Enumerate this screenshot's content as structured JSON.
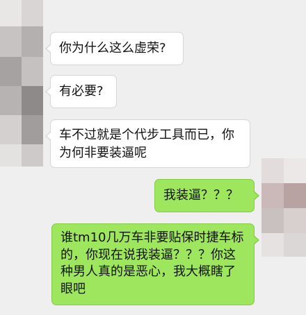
{
  "chat": {
    "messages": [
      {
        "side": "incoming",
        "text": "你为什么这么虚荣?"
      },
      {
        "side": "incoming",
        "text": "有必要?"
      },
      {
        "side": "incoming",
        "text": "车不过就是个代步工具而已，你为何非要装逼呢"
      },
      {
        "side": "outgoing",
        "text": "我装逼？？？"
      },
      {
        "side": "outgoing",
        "text": "谁tm10几万车非要贴保时捷车标的，你现在说我装逼？？？你这种男人真的是恶心，我大概瞎了眼吧"
      }
    ]
  },
  "colors": {
    "background": "#efefef",
    "incoming_bubble": "#ffffff",
    "outgoing_bubble": "#9ee65e"
  },
  "icons": {
    "incoming_avatar": "pixelated-avatar-icon",
    "outgoing_avatar": "pixelated-avatar-icon"
  }
}
